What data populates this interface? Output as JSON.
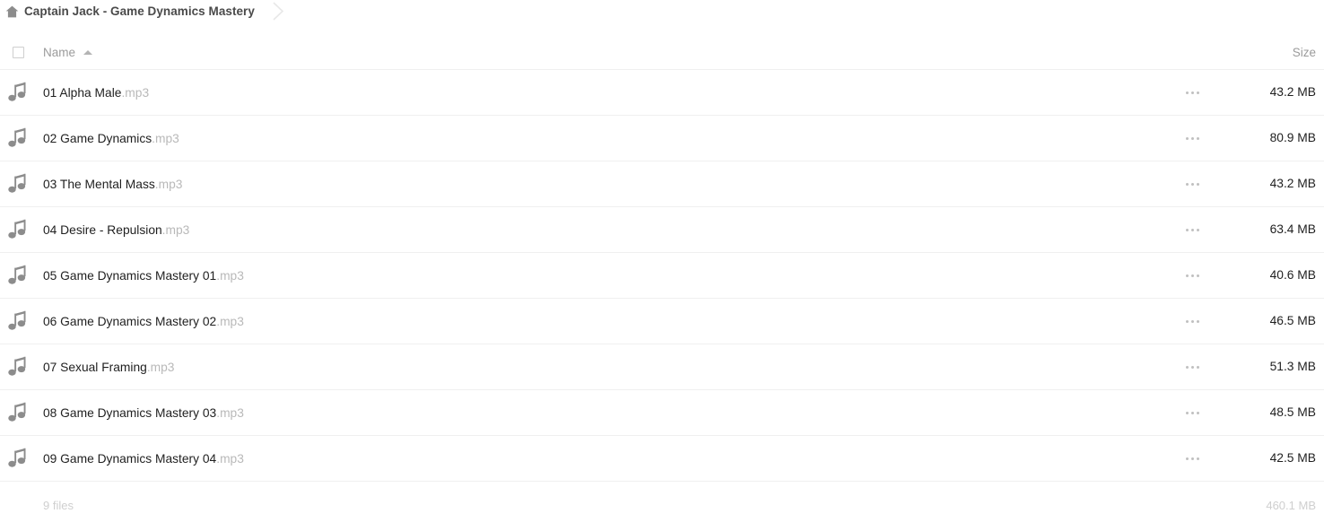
{
  "breadcrumb": {
    "home_icon": "home-icon",
    "path_label": "Captain Jack - Game Dynamics Mastery",
    "separator_icon": "chevron-right-icon"
  },
  "table": {
    "header": {
      "select_all_checkbox": "checkbox-unchecked",
      "name_label": "Name",
      "sort_indicator": "sort-ascending-icon",
      "size_label": "Size",
      "menu_label": ""
    },
    "rows": [
      {
        "icon": "music-note-icon",
        "name": "01 Alpha Male",
        "ext": ".mp3",
        "menu": "overflow-menu-icon",
        "size": "43.2 MB"
      },
      {
        "icon": "music-note-icon",
        "name": "02 Game Dynamics",
        "ext": ".mp3",
        "menu": "overflow-menu-icon",
        "size": "80.9 MB"
      },
      {
        "icon": "music-note-icon",
        "name": "03 The Mental Mass",
        "ext": ".mp3",
        "menu": "overflow-menu-icon",
        "size": "43.2 MB"
      },
      {
        "icon": "music-note-icon",
        "name": "04 Desire - Repulsion",
        "ext": ".mp3",
        "menu": "overflow-menu-icon",
        "size": "63.4 MB"
      },
      {
        "icon": "music-note-icon",
        "name": "05 Game Dynamics Mastery 01",
        "ext": ".mp3",
        "menu": "overflow-menu-icon",
        "size": "40.6 MB"
      },
      {
        "icon": "music-note-icon",
        "name": "06 Game Dynamics Mastery 02",
        "ext": ".mp3",
        "menu": "overflow-menu-icon",
        "size": "46.5 MB"
      },
      {
        "icon": "music-note-icon",
        "name": "07 Sexual Framing",
        "ext": ".mp3",
        "menu": "overflow-menu-icon",
        "size": "51.3 MB"
      },
      {
        "icon": "music-note-icon",
        "name": "08 Game Dynamics Mastery 03",
        "ext": ".mp3",
        "menu": "overflow-menu-icon",
        "size": "48.5 MB"
      },
      {
        "icon": "music-note-icon",
        "name": "09 Game Dynamics Mastery 04",
        "ext": ".mp3",
        "menu": "overflow-menu-icon",
        "size": "42.5 MB"
      }
    ],
    "footer": {
      "file_count": "9 files",
      "total_size": "460.1 MB"
    }
  },
  "colors": {
    "text": "#1f1f1f",
    "muted": "#9b9b9b",
    "faint": "#cfcfcf",
    "extension": "#b9b9b9",
    "icon": "#8c8c8c",
    "divider": "#f0f0f0"
  }
}
